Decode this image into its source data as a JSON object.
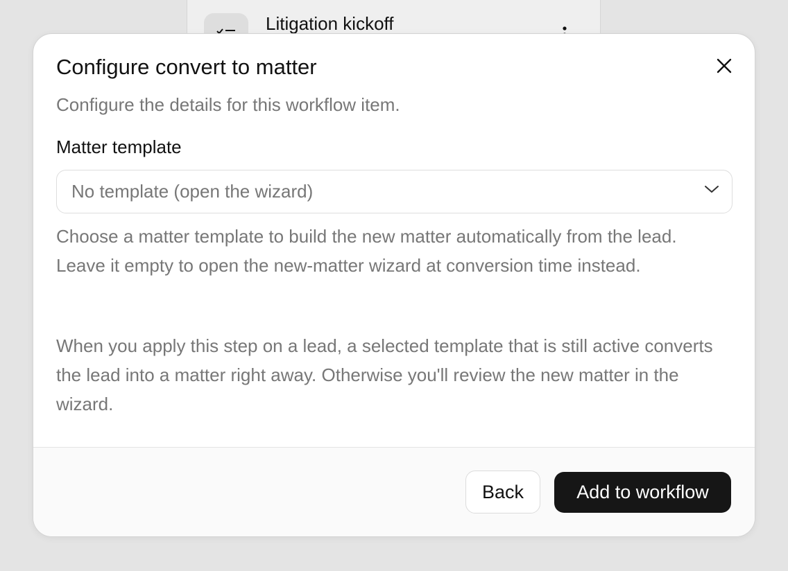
{
  "background_card": {
    "title": "Litigation kickoff",
    "icon": "task-list-icon",
    "menu_icon": "more-vertical-icon"
  },
  "dialog": {
    "title": "Configure convert to matter",
    "close_icon": "close-icon",
    "subtitle": "Configure the details for this workflow item.",
    "field_label": "Matter template",
    "select_value": "No template (open the wizard)",
    "select_icon": "chevron-down-icon",
    "help_1": "Choose a matter template to build the new matter automatically from the lead. Leave it empty to open the new-matter wizard at conversion time instead.",
    "help_2": "When you apply this step on a lead, a selected template that is still active converts the lead into a matter right away. Otherwise you'll review the new matter in the wizard.",
    "back_label": "Back",
    "submit_label": "Add to workflow"
  },
  "colors": {
    "primary_button": "#161616",
    "muted_text": "#777777",
    "backdrop": "#e4e4e4"
  }
}
